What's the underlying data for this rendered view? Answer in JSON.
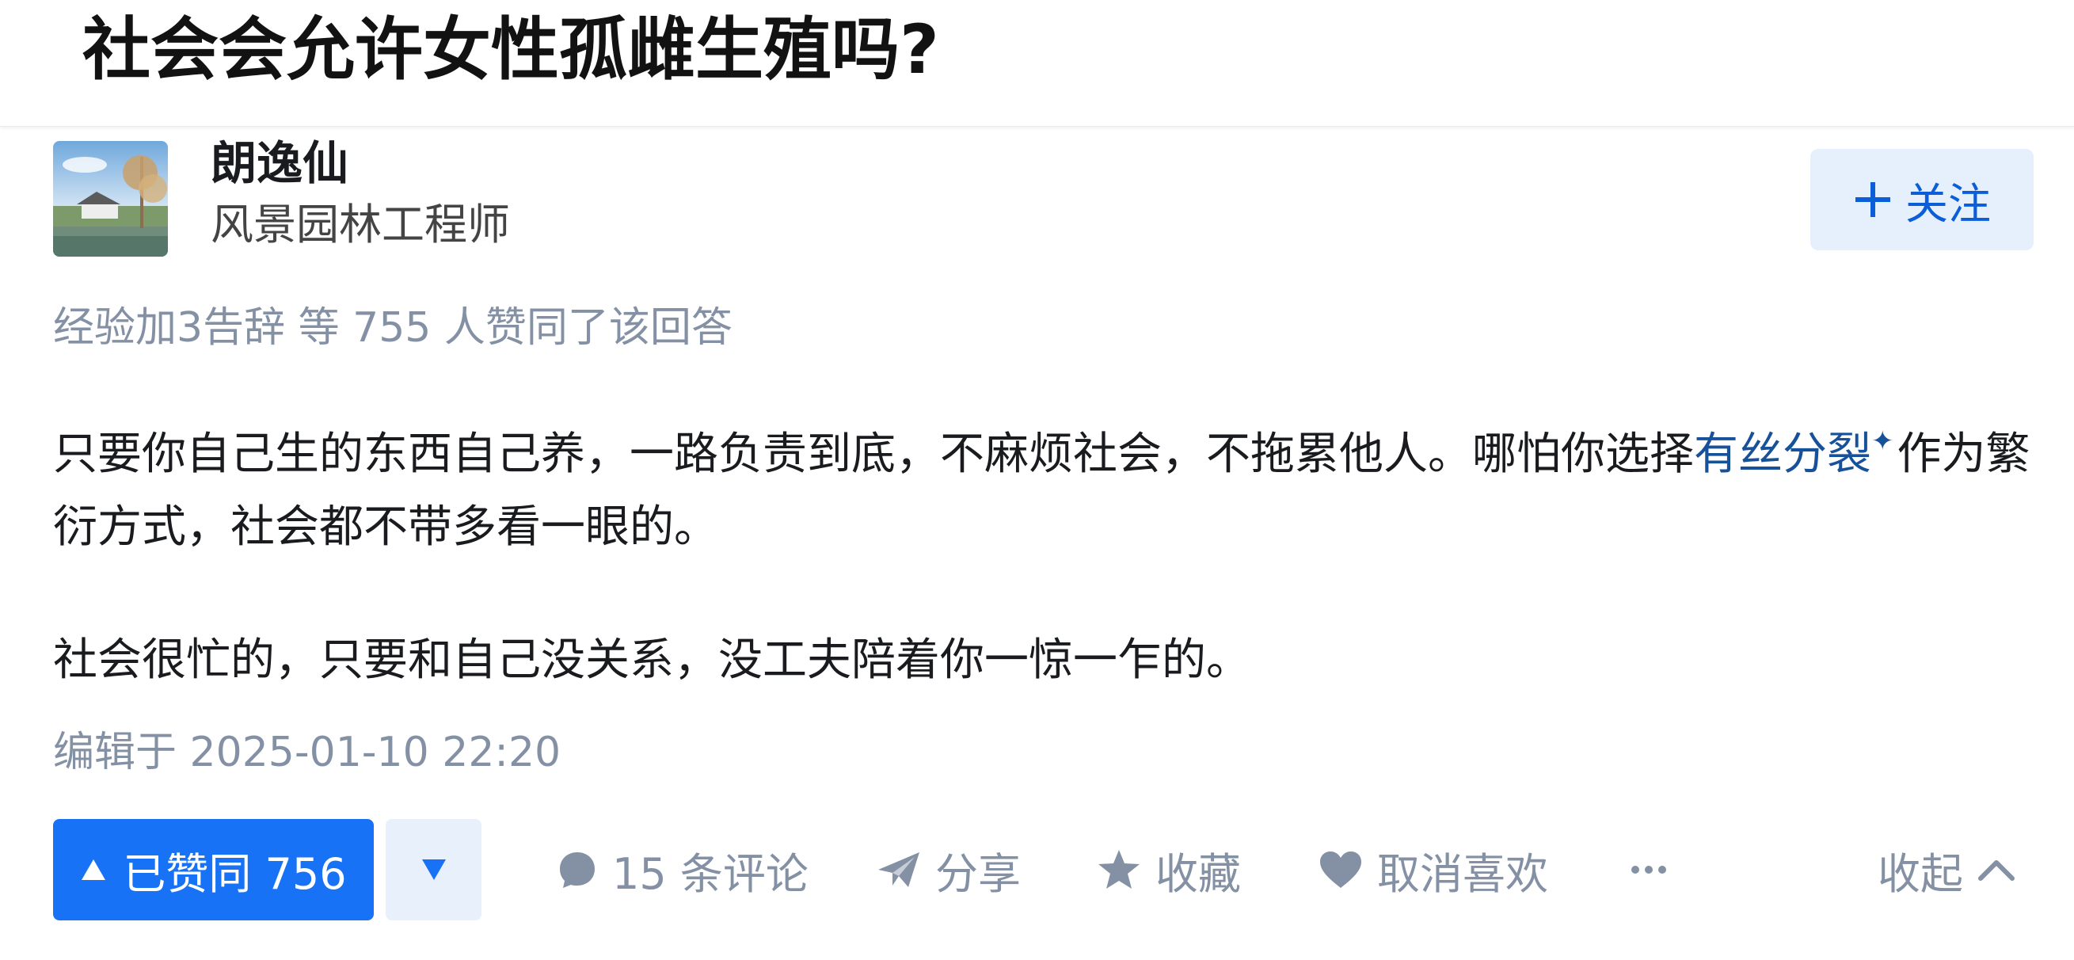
{
  "question": {
    "title": "社会会允许女性孤雌生殖吗?"
  },
  "author": {
    "name": "朗逸仙",
    "headline": "风景园林工程师",
    "follow_label": "关注"
  },
  "vote_summary": "经验加3告辞 等 755 人赞同了该回答",
  "answer": {
    "p1_before": "只要你自己生的东西自己养，一路负责到底，不麻烦社会，不拖累他人。哪怕你选择",
    "p1_link": "有丝分裂",
    "p1_after": "作为繁衍方式，社会都不带多看一眼的。",
    "p2": "社会很忙的，只要和自己没关系，没工夫陪着你一惊一乍的。",
    "edit_time": "编辑于 2025-01-10 22:20"
  },
  "actions": {
    "upvote_label": "已赞同 756",
    "comments_label": "15 条评论",
    "share_label": "分享",
    "favorite_label": "收藏",
    "unlike_label": "取消喜欢",
    "collapse_label": "收起"
  },
  "colors": {
    "brand_blue": "#1772f6",
    "link_blue": "#175199",
    "muted_gray": "#8491a5",
    "follow_bg": "#e6effc"
  },
  "icons": {
    "upvote": "triangle-up-icon",
    "downvote": "triangle-down-icon",
    "comment": "comment-bubble-icon",
    "share": "paper-plane-icon",
    "favorite": "star-icon",
    "like": "heart-icon",
    "more": "ellipsis-icon",
    "collapse": "chevron-up-icon",
    "follow": "plus-icon",
    "link_marker": "sparkle-icon"
  }
}
